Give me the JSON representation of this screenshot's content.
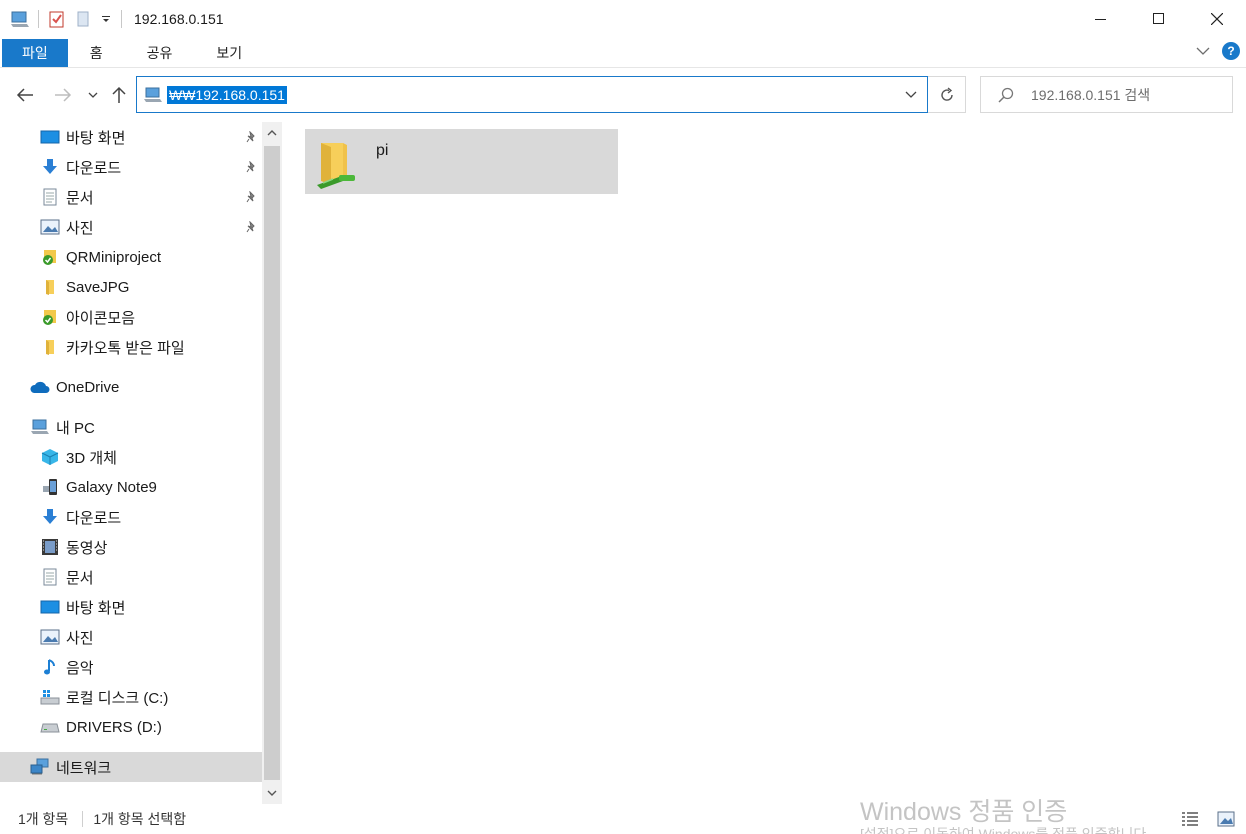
{
  "window": {
    "title": "192.168.0.151"
  },
  "ribbon": {
    "tabs": [
      "파일",
      "홈",
      "공유",
      "보기"
    ]
  },
  "address": {
    "path": "₩₩192.168.0.151",
    "search_placeholder": "192.168.0.151 검색"
  },
  "nav": {
    "quick_access": [
      {
        "label": "바탕 화면",
        "icon": "desktop-icon",
        "pinned": true
      },
      {
        "label": "다운로드",
        "icon": "download-icon",
        "pinned": true
      },
      {
        "label": "문서",
        "icon": "document-icon",
        "pinned": true
      },
      {
        "label": "사진",
        "icon": "picture-icon",
        "pinned": true
      },
      {
        "label": "QRMiniproject",
        "icon": "synced-folder-icon",
        "pinned": false
      },
      {
        "label": "SaveJPG",
        "icon": "folder-icon",
        "pinned": false
      },
      {
        "label": "아이콘모음",
        "icon": "synced-folder-icon",
        "pinned": false
      },
      {
        "label": "카카오톡 받은 파일",
        "icon": "folder-icon",
        "pinned": false
      }
    ],
    "onedrive": "OneDrive",
    "this_pc": "내 PC",
    "pc_items": [
      {
        "label": "3D 개체",
        "icon": "3d-objects-icon"
      },
      {
        "label": "Galaxy Note9",
        "icon": "phone-icon"
      },
      {
        "label": "다운로드",
        "icon": "download-icon"
      },
      {
        "label": "동영상",
        "icon": "video-icon"
      },
      {
        "label": "문서",
        "icon": "document-icon"
      },
      {
        "label": "바탕 화면",
        "icon": "desktop-icon"
      },
      {
        "label": "사진",
        "icon": "picture-icon"
      },
      {
        "label": "음악",
        "icon": "music-icon"
      },
      {
        "label": "로컬 디스크 (C:)",
        "icon": "windows-drive-icon"
      },
      {
        "label": "DRIVERS (D:)",
        "icon": "drive-icon"
      }
    ],
    "network": "네트워크"
  },
  "content": {
    "items": [
      {
        "name": "pi",
        "icon": "network-share-folder-icon"
      }
    ]
  },
  "status": {
    "count": "1개 항목",
    "selected": "1개 항목 선택함"
  },
  "watermark": {
    "line1": "Windows 정품 인증",
    "line2": "[설정]으로 이동하여 Windows를 정품 인증합니다."
  },
  "colors": {
    "accent": "#1979ca",
    "selection": "#0078d7",
    "hover_bg": "#d9d9d9"
  }
}
